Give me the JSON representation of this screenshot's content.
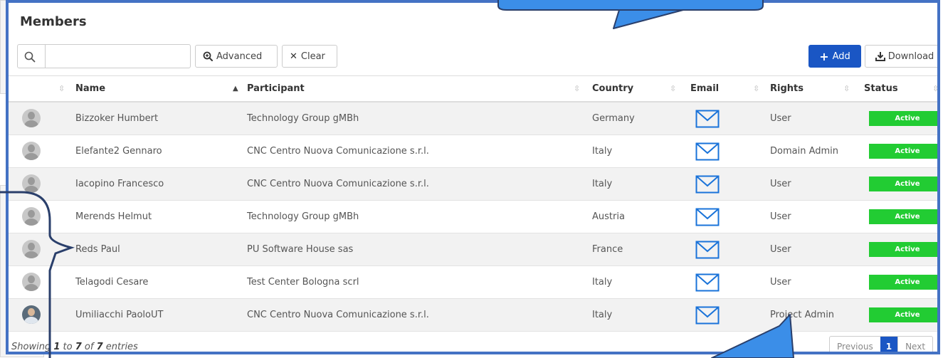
{
  "title": "Members",
  "search": {
    "placeholder": "",
    "value": ""
  },
  "toolbar": {
    "advanced_label": "Advanced",
    "clear_label": "Clear",
    "add_label": "Add",
    "download_label": "Download"
  },
  "columns": [
    "Name",
    "Participant",
    "Country",
    "Email",
    "Rights",
    "Status"
  ],
  "rows": [
    {
      "name": "Bizzoker Humbert",
      "participant": "Technology Group gMBh",
      "country": "Germany",
      "rights": "User",
      "status": "Active"
    },
    {
      "name": "Elefante2 Gennaro",
      "participant": "CNC Centro Nuova Comunicazione s.r.l.",
      "country": "Italy",
      "rights": "Domain Admin",
      "status": "Active"
    },
    {
      "name": "Iacopino Francesco",
      "participant": "CNC Centro Nuova Comunicazione s.r.l.",
      "country": "Italy",
      "rights": "User",
      "status": "Active"
    },
    {
      "name": "Merends Helmut",
      "participant": "Technology Group gMBh",
      "country": "Austria",
      "rights": "User",
      "status": "Active"
    },
    {
      "name": "Reds Paul",
      "participant": "PU Software House sas",
      "country": "France",
      "rights": "User",
      "status": "Active"
    },
    {
      "name": "Telagodi Cesare",
      "participant": "Test Center Bologna scrl",
      "country": "Italy",
      "rights": "User",
      "status": "Active"
    },
    {
      "name": "Umiliacchi PaoloUT",
      "participant": "CNC Centro Nuova Comunicazione s.r.l.",
      "country": "Italy",
      "rights": "Project Admin",
      "status": "Active"
    }
  ],
  "footer": {
    "showing_prefix": "Showing",
    "from": "1",
    "to_word": "to",
    "to": "7",
    "of_word": "of",
    "total": "7",
    "suffix": "entries"
  },
  "pagination": {
    "previous": "Previous",
    "current": "1",
    "next": "Next"
  },
  "colors": {
    "accent": "#1a56c4",
    "status_active": "#22cc33",
    "callout": "#4472c4",
    "arrow": "#3b8ee8"
  },
  "icons": [
    "search-icon",
    "zoom-plus-icon",
    "close-icon",
    "plus-icon",
    "download-icon",
    "sort-icon",
    "sort-asc-icon",
    "mail-icon",
    "avatar-icon"
  ]
}
